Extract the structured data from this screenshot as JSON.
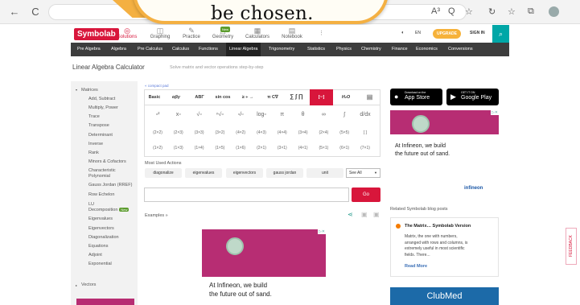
{
  "overlay": {
    "text": "be chosen."
  },
  "browser": {
    "back": "←",
    "reload": "C",
    "tools": [
      "A³",
      "Q",
      "☆",
      "↻",
      "☆",
      "⧉"
    ]
  },
  "header": {
    "logo": "Symbolab",
    "nav": [
      {
        "label": "Solutions",
        "icon": "◎"
      },
      {
        "label": "Graphing",
        "icon": "◫"
      },
      {
        "label": "Practice",
        "icon": "✎"
      },
      {
        "label": "Geometry",
        "icon": "△"
      },
      {
        "label": "Calculators",
        "icon": "▦"
      },
      {
        "label": "Notebook",
        "icon": "▤"
      }
    ],
    "new_badge": "New",
    "more": "⋮",
    "theme": "◐",
    "lang": "EN",
    "upgrade": "UPGRADE",
    "signin": "SIGN IN",
    "search_icon": "⌕"
  },
  "topnav": [
    "Pre Algebra",
    "Algebra",
    "Pre Calculus",
    "Calculus",
    "Functions",
    "Linear Algebra",
    "Trigonometry",
    "Statistics",
    "Physics",
    "Chemistry",
    "Finance",
    "Economics",
    "Conversions"
  ],
  "page": {
    "title": "Linear Algebra Calculator",
    "subtitle": "Solve matrix and vector operations step-by-step"
  },
  "sidebar": {
    "items": [
      "Matrices",
      "Add, Subtract",
      "Multiply, Power",
      "Trace",
      "Transpose",
      "Determinant",
      "Inverse",
      "Rank",
      "Minors & Cofactors",
      "Characteristic",
      "Polynomial",
      "Gauss Jordan (RREF)",
      "Row Echelon",
      "LU",
      "Decomposition",
      "Eigenvalues",
      "Eigenvectors",
      "Diagonalization",
      "Equations",
      "Adjoint",
      "Exponential",
      "Vectors"
    ],
    "new_badge": "New"
  },
  "calculator": {
    "compact_label": "« compact pad",
    "tabs": [
      "Basic",
      "αβγ",
      "ABΓ",
      "sin cos",
      "≥ ÷ → ",
      "π C∇",
      "∑ ∫ ∏",
      "[▫▫]",
      "H₂O",
      "▤"
    ],
    "keys_row1": [
      "▫²",
      "x▫",
      "√▫",
      "ⁿ√▫",
      "▫/▫",
      "log▫",
      "π",
      "θ",
      "∞",
      "∫",
      "d/dx"
    ],
    "keys_row2": [
      "(2×2)",
      "(2×3)",
      "(3×3)",
      "(3×2)",
      "(4×2)",
      "(4×3)",
      "(4×4)",
      "(3×4)",
      "(2×4)",
      "(5×5)",
      "[ ]"
    ],
    "keys_row3": [
      "(1×2)",
      "(1×3)",
      "(1×4)",
      "(1×5)",
      "(1×6)",
      "(2×1)",
      "(3×1)",
      "(4×1)",
      "(5×1)",
      "(6×1)",
      "(7×1)"
    ],
    "most_used_label": "Most Used Actions",
    "most_used": [
      "diagonalize",
      "eigenvalues",
      "eigenvectors",
      "gauss jordan",
      "unit"
    ],
    "see_all": "See All",
    "go": "Go",
    "examples": "Examples »"
  },
  "ads": {
    "infineon_line1": "At Infineon, we build",
    "infineon_line2": "the future out of sand.",
    "infineon_logo": "infineon",
    "clubmed": "ClubMed"
  },
  "apps": {
    "apple_small": "Download on the",
    "apple_big": "App Store",
    "google_small": "GET IT ON",
    "google_big": "Google Play"
  },
  "related": {
    "label": "Related Symbolab blog posts",
    "post_title": "The Matrix… Symbolab Version",
    "post_body": [
      "Matrix, the one with numbers,",
      "arranged with rows and columns, is",
      "extremely useful in most scientific",
      "fields. There..."
    ],
    "read_more": "Read More"
  },
  "feedback": "FEEDBACK",
  "colors": {
    "brand": "#d8163b",
    "accent": "#00a7a7",
    "upgrade": "#f6b23a",
    "ad": "#b72d73"
  }
}
